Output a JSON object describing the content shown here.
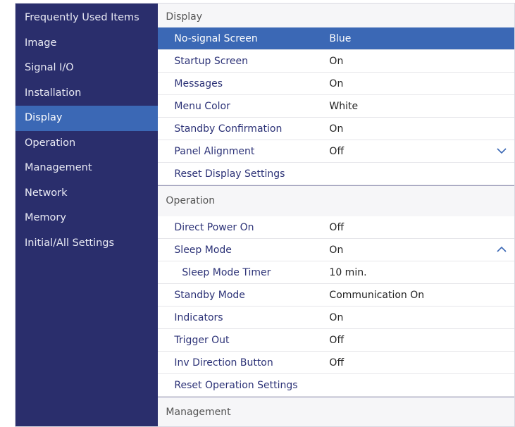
{
  "sidebar": {
    "items": [
      {
        "label": "Frequently Used Items"
      },
      {
        "label": "Image"
      },
      {
        "label": "Signal I/O"
      },
      {
        "label": "Installation"
      },
      {
        "label": "Display",
        "active": true
      },
      {
        "label": "Operation"
      },
      {
        "label": "Management"
      },
      {
        "label": "Network"
      },
      {
        "label": "Memory"
      },
      {
        "label": "Initial/All Settings"
      }
    ]
  },
  "display": {
    "header": "Display",
    "rows": [
      {
        "label": "No-signal Screen",
        "value": "Blue"
      },
      {
        "label": "Startup Screen",
        "value": "On"
      },
      {
        "label": "Messages",
        "value": "On"
      },
      {
        "label": "Menu Color",
        "value": "White"
      },
      {
        "label": "Standby Confirmation",
        "value": "On"
      },
      {
        "label": "Panel Alignment",
        "value": "Off"
      },
      {
        "label": "Reset Display Settings"
      }
    ]
  },
  "operation": {
    "header": "Operation",
    "rows": [
      {
        "label": "Direct Power On",
        "value": "Off"
      },
      {
        "label": "Sleep Mode",
        "value": "On"
      },
      {
        "label": "Sleep Mode Timer",
        "value": "10 min."
      },
      {
        "label": "Standby Mode",
        "value": "Communication On"
      },
      {
        "label": "Indicators",
        "value": "On"
      },
      {
        "label": "Trigger Out",
        "value": "Off"
      },
      {
        "label": "Inv Direction Button",
        "value": "Off"
      },
      {
        "label": "Reset Operation Settings"
      }
    ]
  },
  "management": {
    "header": "Management"
  },
  "colors": {
    "sidebar_bg": "#2a2e6c",
    "selection": "#3b68b5",
    "label_text": "#2c3277"
  }
}
